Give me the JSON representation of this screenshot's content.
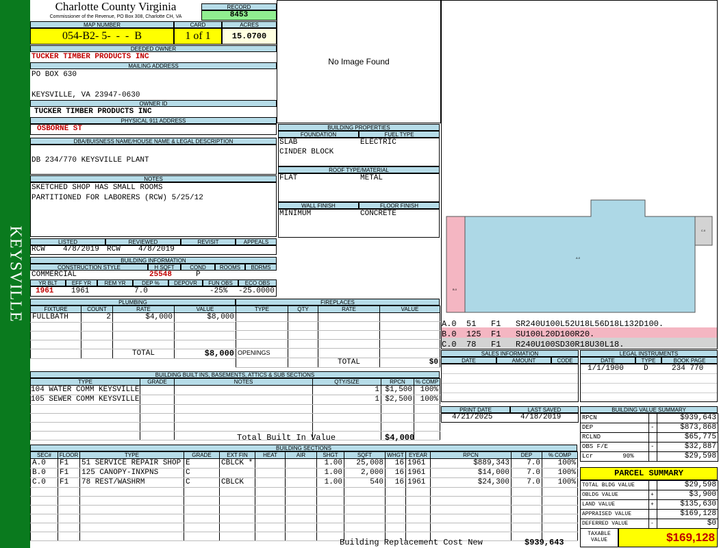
{
  "side_label": "KEYSVILLE",
  "county": {
    "title": "Charlotte County Virginia",
    "subtitle": "Commissioner of the Revenue, PO Box 308, Charlotte CH, VA"
  },
  "record": {
    "label": "RECORD",
    "value": "8453"
  },
  "map": {
    "label": "MAP NUMBER",
    "value": "054-B2- 5-  -  -  B"
  },
  "card": {
    "label": "CARD",
    "value": "1 of 1"
  },
  "acres": {
    "label": "ACRES",
    "value": "15.0700"
  },
  "deeded_owner": {
    "label": "DEEDED OWNER",
    "value": "TUCKER TIMBER PRODUCTS INC"
  },
  "mailing": {
    "label": "MAILING ADDRESS",
    "line1": "PO BOX 630",
    "line2": "KEYSVILLE, VA 23947-0630"
  },
  "owner_id": {
    "label": "OWNER ID",
    "value": "TUCKER TIMBER PRODUCTS INC"
  },
  "physical": {
    "label": "PHYSICAL 911 ADDRESS",
    "value": "OSBORNE ST"
  },
  "legal_desc": {
    "label": "DBA/BUISNESS NAME/HOUSE NAME & LEGAL DESCRIPTION",
    "value": "DB 234/770 KEYSVILLE PLANT"
  },
  "notes": {
    "label": "NOTES",
    "line1": "SKETCHED SHOP HAS SMALL ROOMS",
    "line2": "PARTITIONED FOR LABORERS (RCW) 5/25/12"
  },
  "photo": {
    "text": "No Image Found"
  },
  "bldg_props": {
    "label": "BUILDING PROPERTIES",
    "foundation_label": "FOUNDATION",
    "fuel_label": "FUEL TYPE",
    "foundation1": "SLAB",
    "foundation2": "CINDER BLOCK",
    "fuel": "ELECTRIC",
    "roof_label": "ROOF TYPE/MATERIAL",
    "roof_type": "FLAT",
    "roof_mat": "METAL",
    "wall_label": "WALL FINISH",
    "floor_label": "FLOOR FINISH",
    "wall": "MINIMUM",
    "floor": "CONCRETE"
  },
  "listing": {
    "listed_label": "LISTED",
    "reviewed_label": "REVIEWED",
    "revisit_label": "REVISIT",
    "appeals_label": "APPEALS",
    "listed_by": "RCW",
    "listed_date": "4/8/2019",
    "reviewed_by": "RCW",
    "reviewed_date": "4/8/2019"
  },
  "bldg_info": {
    "label": "BUILDING INFORMATION",
    "cs_label": "CONSTRUCTION STYLE",
    "hsqft_label": "H SQFT",
    "cond_label": "COND",
    "rooms_label": "ROOMS",
    "bdrms_label": "BDRMS",
    "cs": "COMMERCIAL",
    "hsqft": "25548",
    "cond": "P",
    "yrblt_label": "YR BLT",
    "effyr_label": "EFF YR",
    "remyr_label": "REM YR",
    "dep_label": "DEP %",
    "depovr_label": "DEPOVR",
    "funobs_label": "FUN OBS",
    "ecoobs_label": "ECO OBS",
    "yrblt": "1961",
    "effyr": "1961",
    "dep": "7.0",
    "funobs": "-25%",
    "ecoobs": "-25.0000"
  },
  "plumbing": {
    "label": "PLUMBING",
    "headers": [
      "FIXTURE",
      "COUNT",
      "RATE",
      "VALUE"
    ],
    "rows": [
      [
        "FULLBATH",
        "2",
        "$4,000",
        "$8,000"
      ]
    ],
    "total_label": "TOTAL",
    "total": "$8,000"
  },
  "fireplaces": {
    "label": "FIREPLACES",
    "headers": [
      "TYPE",
      "QTY",
      "RATE",
      "VALUE"
    ],
    "openings_label": "OPENINGS",
    "total_label": "TOTAL",
    "total": "$0"
  },
  "sketch": {
    "labels": [
      "A.0  51   F1   SR240U100L52U18L56D18L132D100.",
      "B.0  125  F1   SU100L20D100R20.",
      "C.0  78   F1   R240U100SD30R18U30L18."
    ],
    "colors": [
      "#ffffff",
      "#f4b6c2",
      "#d3d3d3"
    ],
    "main_color": "#add8e6",
    "canopy_color": "#f4b6c2",
    "rest_color": "#d3d3d3"
  },
  "sales": {
    "label": "SALES INFORMATION",
    "headers": [
      "DATE",
      "AMOUNT",
      "CODE"
    ]
  },
  "legal": {
    "label": "LEGAL INSTRUMENTS",
    "headers": [
      "DATE",
      "TYPE",
      "BOOK PAGE"
    ],
    "rows": [
      [
        "1/1/1900",
        "D",
        "234 770"
      ]
    ]
  },
  "builtins": {
    "label": "BUILDING BUILT INS, BASEMENTS, ATTICS & SUB SECTIONS",
    "headers": [
      "TYPE",
      "GRADE",
      "NOTES",
      "QTY/SIZE",
      "RPCN",
      "% COMP"
    ],
    "rows": [
      [
        "104 WATER COMM KEYSVILLE",
        "",
        "",
        "1",
        "$1,500",
        "100%"
      ],
      [
        "105 SEWER COMM KEYSVILLE",
        "",
        "",
        "1",
        "$2,500",
        "100%"
      ]
    ],
    "total_label": "Total Built In Value",
    "total": "$4,000"
  },
  "print": {
    "print_label": "PRINT DATE",
    "saved_label": "LAST SAVED",
    "print_date": "4/21/2025",
    "saved_date": "4/18/2019"
  },
  "value_summary": {
    "label": "BUILDING VALUE SUMMARY",
    "rows": [
      [
        "RPCN",
        "",
        "$939,643"
      ],
      [
        "DEP",
        "-",
        "$873,868"
      ],
      [
        "RCLND",
        "",
        "$65,775"
      ],
      [
        "OBS F/E",
        "-",
        "$32,887"
      ],
      [
        "Lcr        90%",
        "",
        "$29,598"
      ]
    ]
  },
  "parcel": {
    "label": "PARCEL SUMMARY",
    "rows": [
      [
        "TOTAL BLDG VALUE",
        "",
        "$29,598"
      ],
      [
        "OBLDG VALUE",
        "+",
        "$3,900"
      ],
      [
        "LAND VALUE",
        "+",
        "$135,630"
      ],
      [
        "APPRAISED VALUE",
        "",
        "$169,128"
      ],
      [
        "DEFERRED VALUE",
        "-",
        "$0"
      ]
    ],
    "taxable_label": "TAXABLE VALUE",
    "taxable": "$169,128",
    "accent": "#ffff00"
  },
  "sections": {
    "label": "BUILDING SECTIONS",
    "headers": [
      "SEC#",
      "FLOOR",
      "TYPE",
      "GRADE",
      "EXT FIN",
      "HEAT",
      "AIR",
      "SHGT",
      "SQFT",
      "WHGT",
      "EYEAR",
      "RPCN",
      "DEP",
      "% COMP"
    ],
    "rows": [
      [
        "A.0",
        "F1",
        "51 SERVICE REPAIR SHOP",
        "E",
        "CBLCK *",
        "",
        "",
        "1.00",
        "25,008",
        "16",
        "1961",
        "$889,343",
        "7.0",
        "100%"
      ],
      [
        "B.0",
        "F1",
        "125 CANOPY-INXPNS",
        "C",
        "",
        "",
        "",
        "1.00",
        "2,000",
        "16",
        "1961",
        "$14,000",
        "7.0",
        "100%"
      ],
      [
        "C.0",
        "F1",
        "78 REST/WASHRM",
        "C",
        "CBLCK",
        "",
        "",
        "1.00",
        "540",
        "16",
        "1961",
        "$24,300",
        "7.0",
        "100%"
      ]
    ],
    "total_label": "Building Replacement Cost New",
    "total": "$939,643"
  }
}
